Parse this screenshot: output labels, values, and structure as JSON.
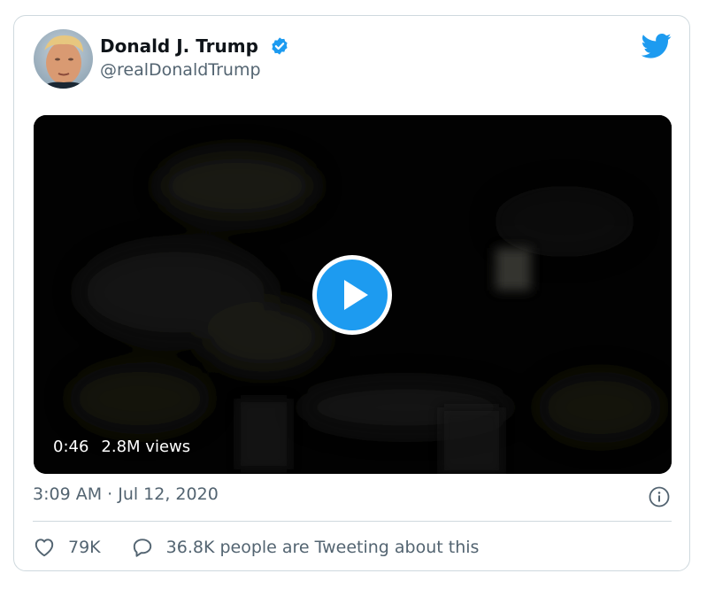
{
  "tweet": {
    "author_name": "Donald J. Trump",
    "author_handle": "@realDonaldTrump",
    "timestamp": "3:09 AM · Jul 12, 2020"
  },
  "video": {
    "duration": "0:46",
    "views": "2.8M views"
  },
  "actions": {
    "likes": "79K",
    "reply_text": "36.8K people are Tweeting about this"
  },
  "colors": {
    "twitter_blue": "#1d9bf0",
    "secondary_text": "#536471",
    "border": "#cfd9de"
  },
  "icons": [
    "avatar",
    "verified-badge-icon",
    "twitter-bird-icon",
    "play-icon",
    "info-icon",
    "heart-icon",
    "reply-bubble-icon"
  ]
}
